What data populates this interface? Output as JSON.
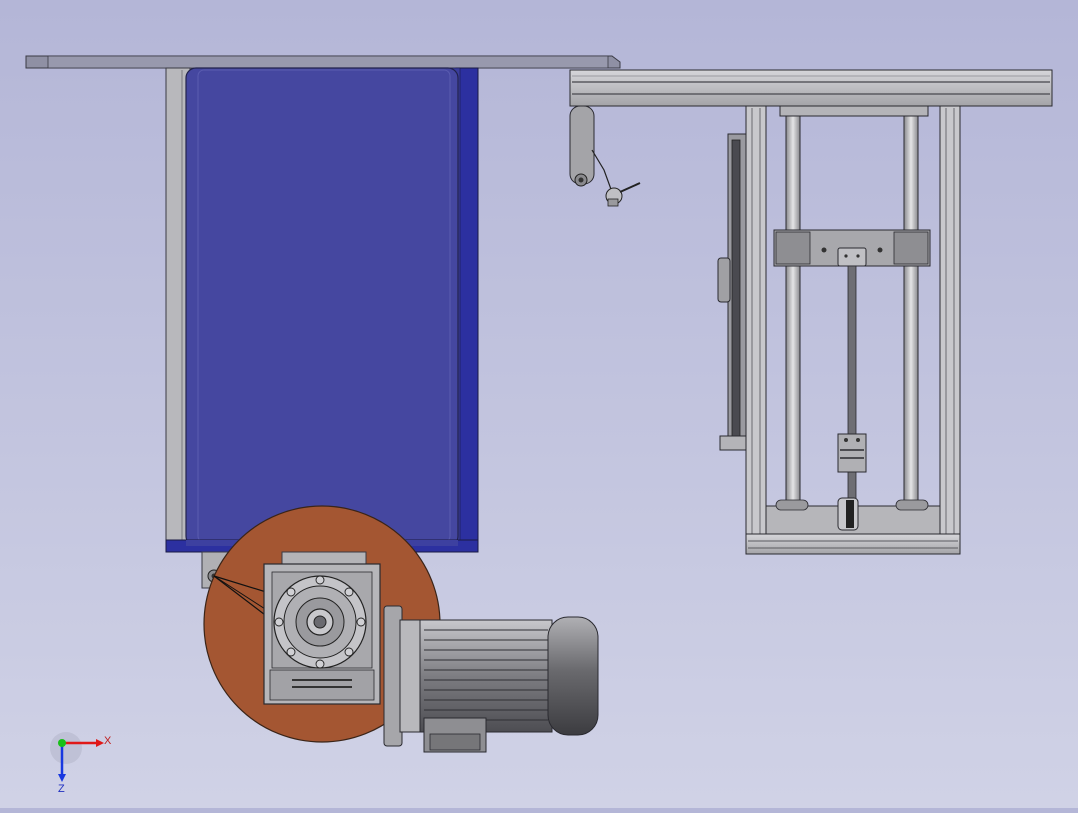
{
  "viewport": {
    "background_top": "#b4b6d7",
    "background_bottom": "#d0d2e6"
  },
  "model": {
    "hopper_color": "#4547a0",
    "hopper_edge_color": "#2b2e9a",
    "frame_color": "#b9b9bd",
    "disc_color": "#a45632",
    "motor_color": "#8d8d92"
  },
  "triad": {
    "x_label": "X",
    "z_label": "Z",
    "x_color": "#e01818",
    "y_color": "#18c018",
    "z_color": "#1838e0"
  }
}
